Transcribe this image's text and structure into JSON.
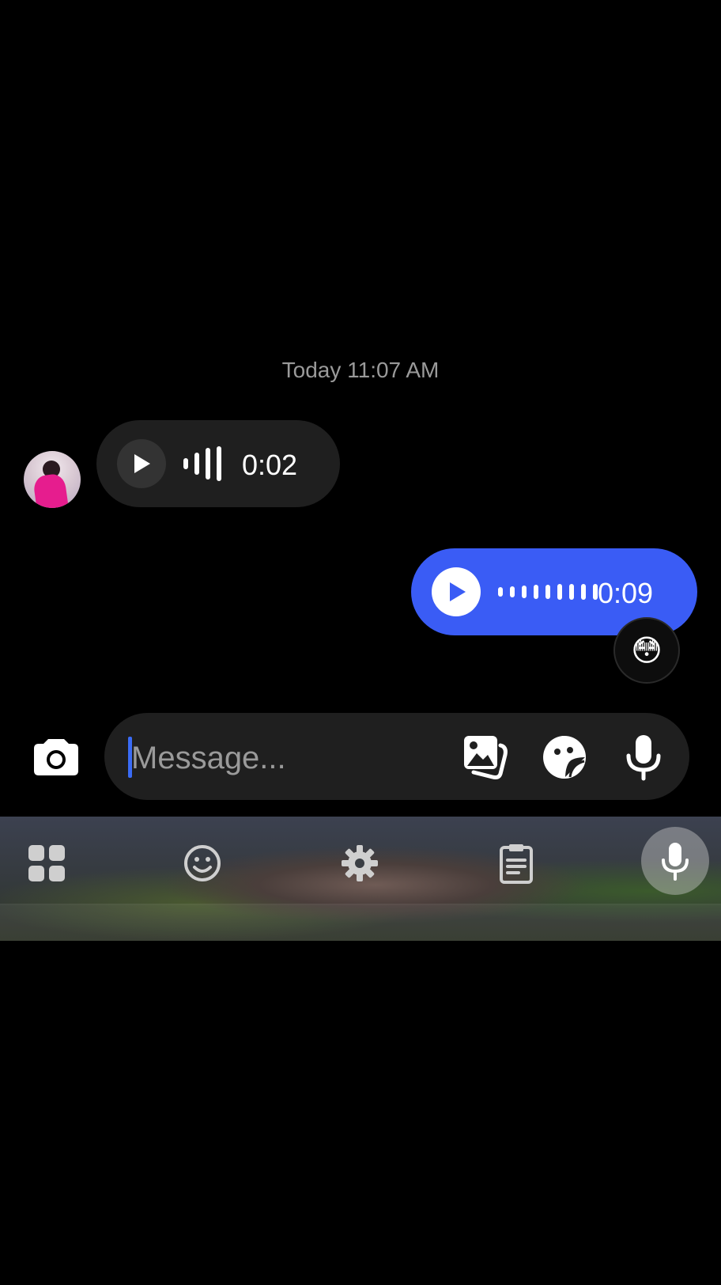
{
  "conversation": {
    "timestamp": "Today 11:07 AM",
    "messages": [
      {
        "direction": "incoming",
        "type": "voice",
        "duration": "0:02"
      },
      {
        "direction": "outgoing",
        "type": "voice",
        "duration": "0:09",
        "reaction": "😳"
      }
    ]
  },
  "composer": {
    "placeholder": "Message...",
    "value": ""
  },
  "icons": {
    "camera": "camera-icon",
    "gallery": "image-gallery-icon",
    "sticker": "sticker-icon",
    "microphone": "microphone-icon",
    "keyboard_grid": "grid-icon",
    "emoji": "smiley-icon",
    "settings": "gear-icon",
    "clipboard": "clipboard-icon",
    "voice_input": "microphone-icon"
  },
  "colors": {
    "outgoing_bubble": "#3a5cf5",
    "incoming_bubble": "#1f1f1f",
    "background": "#000000",
    "caret": "#3a6bf5"
  }
}
